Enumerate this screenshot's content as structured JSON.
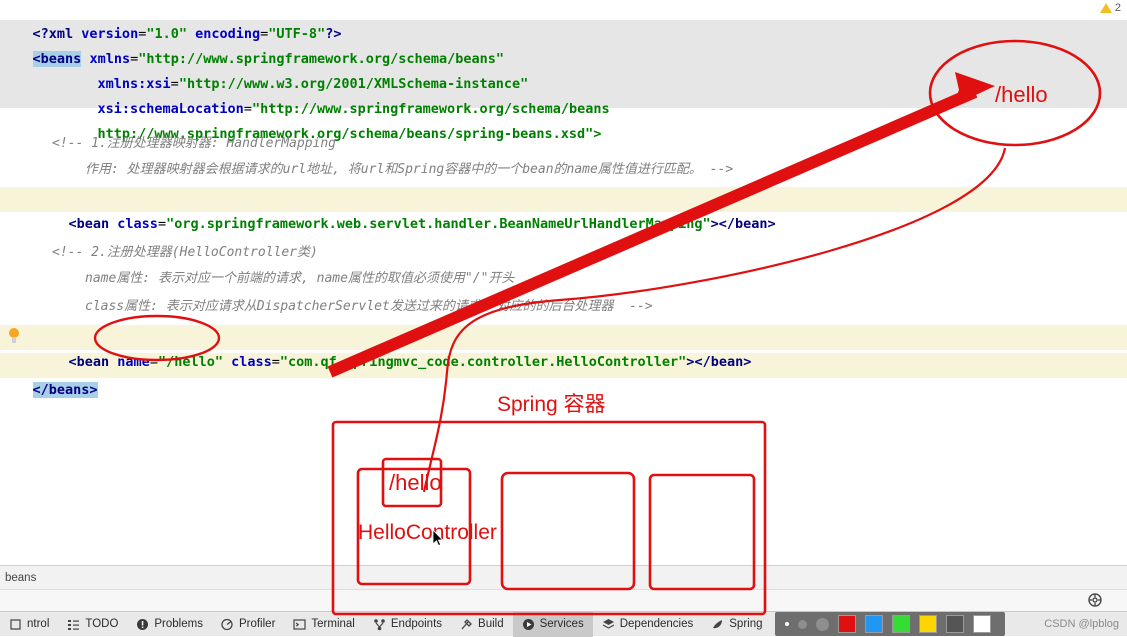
{
  "editor": {
    "lines": [
      {
        "id": "l1",
        "text": "<?xml version=\"1.0\" encoding=\"UTF-8\"?>"
      },
      {
        "id": "l2",
        "text": "<beans xmlns=\"http://www.springframework.org/schema/beans\""
      },
      {
        "id": "l3",
        "text": "xmlns:xsi=\"http://www.w3.org/2001/XMLSchema-instance\""
      },
      {
        "id": "l4",
        "text": "xsi:schemaLocation=\"http://www.springframework.org/schema/beans"
      },
      {
        "id": "l5",
        "text": "http://www.springframework.org/schema/beans/spring-beans.xsd\">"
      },
      {
        "id": "l6",
        "text": "<!-- 1.注册处理器映射器: HandlerMapping"
      },
      {
        "id": "l7",
        "text": "作用: 处理器映射器会根据请求的url地址, 将url和Spring容器中的一个bean的name属性值进行匹配。 -->"
      },
      {
        "id": "l8",
        "text": "<bean class=\"org.springframework.web.servlet.handler.BeanNameUrlHandlerMapping\"></bean>"
      },
      {
        "id": "l9",
        "text": "<!-- 2.注册处理器(HelloController类)"
      },
      {
        "id": "l10",
        "text": "name属性: 表示对应一个前端的请求, name属性的取值必须使用\"/\"开头"
      },
      {
        "id": "l11",
        "text": "class属性: 表示对应请求从DispatcherServlet发送过来的请求, 对应的的后台处理器  -->"
      },
      {
        "id": "l12",
        "text": "<bean name=\"/hello\" class=\"com.qf.springmvc_code.controller.HelloController\"></bean>"
      },
      {
        "id": "l13",
        "text": "</beans>"
      }
    ],
    "tokens": {
      "xml_decl_open": "<?xml",
      "xml_decl_version_attr": "version",
      "xml_decl_version_val": "\"1.0\"",
      "xml_decl_encoding_attr": "encoding",
      "xml_decl_encoding_val": "\"UTF-8\"",
      "xml_decl_close": "?>",
      "beans_open": "<beans",
      "xmlns_attr": "xmlns",
      "xmlns_val": "\"http://www.springframework.org/schema/beans\"",
      "xmlns_xsi_attr": "xmlns:xsi",
      "xmlns_xsi_val": "\"http://www.w3.org/2001/XMLSchema-instance\"",
      "schemaloc_attr": "xsi:schemaLocation",
      "schemaloc_val_1": "\"http://www.springframework.org/schema/beans",
      "schemaloc_val_2": "http://www.springframework.org/schema/beans/spring-beans.xsd\">",
      "comment1_a": "<!-- 1.注册处理器映射器: HandlerMapping",
      "comment1_b": "作用: 处理器映射器会根据请求的url地址, 将url和Spring容器中的一个bean的name属性值进行匹配。 -->",
      "bean1_open": "<bean",
      "class_attr": "class",
      "bean1_class_val": "\"org.springframework.web.servlet.handler.BeanNameUrlHandlerMapping\"",
      "bean_close_gt": ">",
      "bean_end": "</bean>",
      "comment2_a": "<!-- 2.注册处理器(HelloController类)",
      "comment2_b": "name属性: 表示对应一个前端的请求, name属性的取值必须使用\"/\"开头",
      "comment2_c": "class属性: 表示对应请求从DispatcherServlet发送过来的请求, 对应的的后台处理器  -->",
      "bean2_open": "<bean",
      "name_attr": "name",
      "bean2_name_val": "\"/hello\"",
      "bean2_class_val": "\"com.qf.springmvc_code.controller.HelloController\"",
      "beans_close": "</beans>",
      "eq": "="
    }
  },
  "breadcrumb": {
    "path": "beans"
  },
  "warnings": {
    "count": "2",
    "icon": "warning-triangle-icon"
  },
  "statusbar": {
    "items": [
      {
        "label": "ntrol",
        "icon": "version-control-icon",
        "active": false
      },
      {
        "label": "TODO",
        "icon": "todo-icon",
        "active": false
      },
      {
        "label": "Problems",
        "icon": "problems-icon",
        "active": false
      },
      {
        "label": "Profiler",
        "icon": "profiler-icon",
        "active": false
      },
      {
        "label": "Terminal",
        "icon": "terminal-icon",
        "active": false
      },
      {
        "label": "Endpoints",
        "icon": "endpoints-icon",
        "active": false
      },
      {
        "label": "Build",
        "icon": "build-hammer-icon",
        "active": false
      },
      {
        "label": "Services",
        "icon": "services-play-icon",
        "active": true
      },
      {
        "label": "Dependencies",
        "icon": "dependencies-icon",
        "active": false
      },
      {
        "label": "Spring",
        "icon": "spring-leaf-icon",
        "active": false
      }
    ],
    "watermark": "CSDN @lpblog"
  },
  "annotation_toolbar": {
    "swatches": [
      "#e01010",
      "#2196f3",
      "#33dd33",
      "#ffd400",
      "#555555",
      "#ffffff"
    ]
  },
  "annotations": {
    "callout_hello": "/hello",
    "spring_container_label": "Spring 容器",
    "box_hello_label": "/hello",
    "box_controller_label": "HelloController",
    "ink_color": "#e01010"
  },
  "colors": {
    "tag": "#000080",
    "attr": "#0000c0",
    "string": "#008000",
    "comment": "#808080",
    "selection": "#a8cfe8",
    "highlight_yellow": "#f8f4d9",
    "grey_band": "#e6e6e6",
    "statusbar_bg": "#e9e9e9",
    "annotation_red": "#e01010"
  }
}
